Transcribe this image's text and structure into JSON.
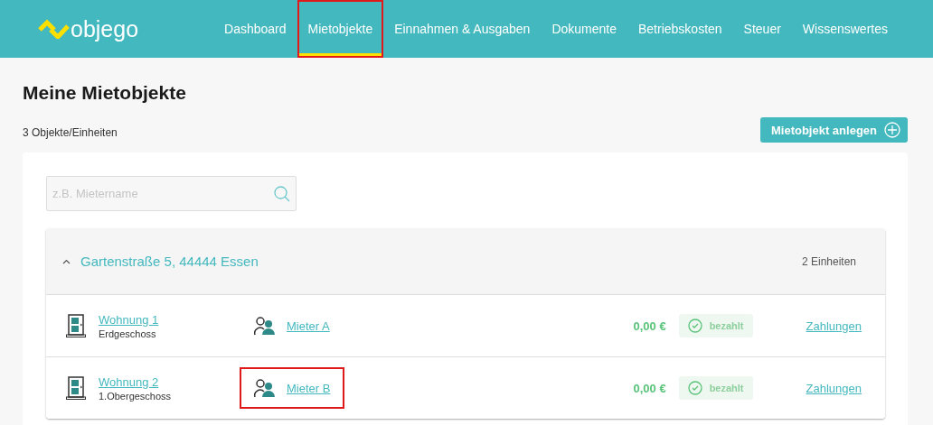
{
  "header": {
    "logo": "objego",
    "nav": [
      {
        "label": "Dashboard",
        "selected": false,
        "highlighted": false
      },
      {
        "label": "Mietobjekte",
        "selected": true,
        "highlighted": true
      },
      {
        "label": "Einnahmen & Ausgaben",
        "selected": false,
        "highlighted": false
      },
      {
        "label": "Dokumente",
        "selected": false,
        "highlighted": false
      },
      {
        "label": "Betriebskosten",
        "selected": false,
        "highlighted": false
      },
      {
        "label": "Steuer",
        "selected": false,
        "highlighted": false
      },
      {
        "label": "Wissenswertes",
        "selected": false,
        "highlighted": false
      }
    ]
  },
  "page": {
    "title": "Meine Mietobjekte",
    "count": "3 Objekte/Einheiten",
    "add_button": "Mietobjekt anlegen"
  },
  "search": {
    "placeholder": "z.B. Mietername"
  },
  "property": {
    "address": "Gartenstraße 5, 44444 Essen",
    "expanded": true,
    "units_count": "2 Einheiten",
    "units": [
      {
        "name": "Wohnung 1",
        "floor": "Erdgeschoss",
        "tenant": "Mieter A",
        "tenant_highlighted": false,
        "amount": "0,00 €",
        "status": "bezahlt",
        "paid": true,
        "payments": "Zahlungen"
      },
      {
        "name": "Wohnung 2",
        "floor": "1.Obergeschoss",
        "tenant": "Mieter B",
        "tenant_highlighted": true,
        "amount": "0,00 €",
        "status": "bezahlt",
        "paid": true,
        "payments": "Zahlungen"
      }
    ]
  }
}
